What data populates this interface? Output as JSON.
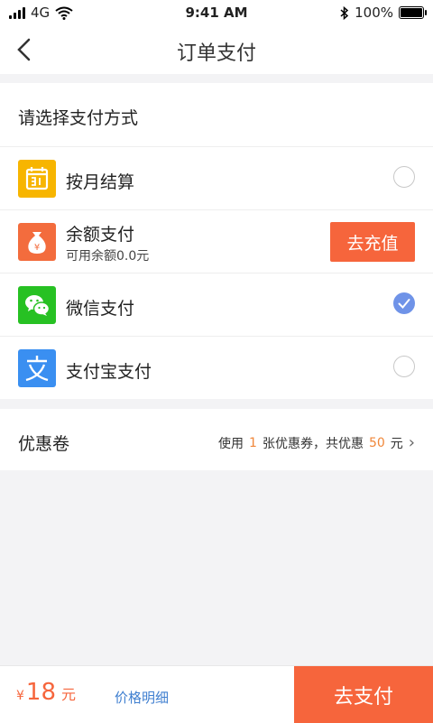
{
  "status": {
    "carrier": "4G",
    "time": "9:41 AM",
    "battery_text": "100%",
    "battery_level": 1.0
  },
  "nav": {
    "title": "订单支付"
  },
  "payment": {
    "heading": "请选择支付方式",
    "methods": [
      {
        "label": "按月结算",
        "icon": "calendar-icon",
        "color": "#f7b500",
        "selected": false
      },
      {
        "label": "余额支付",
        "sub": "可用余额0.0元",
        "icon": "money-bag-icon",
        "color": "#f36c3d",
        "action": "去充值"
      },
      {
        "label": "微信支付",
        "icon": "wechat-icon",
        "color": "#27c123",
        "selected": true
      },
      {
        "label": "支付宝支付",
        "icon": "alipay-icon",
        "color": "#3a8ff1",
        "selected": false
      }
    ]
  },
  "coupon": {
    "label": "优惠卷",
    "text_prefix": "使用",
    "count": "1",
    "text_mid": "张优惠券，共优惠",
    "amount": "50",
    "text_suffix": "元",
    "chevron": "›"
  },
  "bottom": {
    "currency": "¥",
    "total": "18",
    "unit": "元",
    "detail_link": "价格明细",
    "pay_button": "去支付"
  },
  "colors": {
    "accent": "#f6653c",
    "check": "#6f93e8",
    "link": "#3f7fd0",
    "highlight": "#f0873a"
  }
}
